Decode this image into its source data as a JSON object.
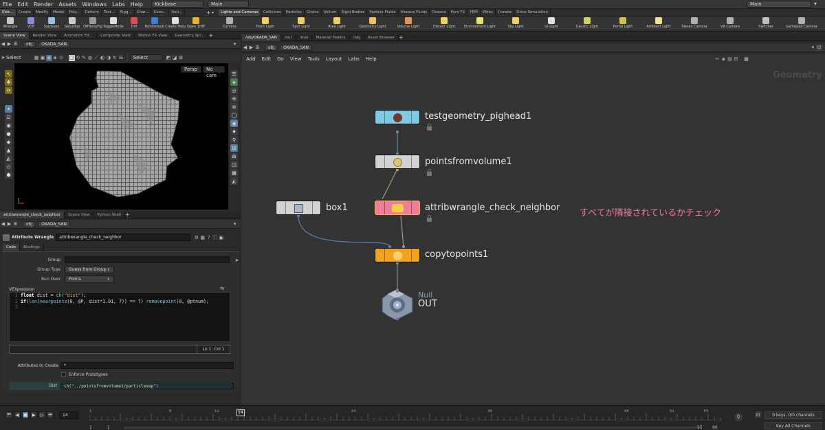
{
  "menu": {
    "items": [
      "File",
      "Edit",
      "Render",
      "Assets",
      "Windows",
      "Labs",
      "Help"
    ],
    "desktop": "Kickbase",
    "scene": "Main",
    "scene_right": "Main"
  },
  "shelf_tabs_left": [
    "Kick...",
    "Create",
    "Modify",
    "Model",
    "Poly...",
    "Deform",
    "Text...",
    "Rigg...",
    "Char...",
    "Cons...",
    "Hair..."
  ],
  "shelf_tabs_right": [
    "Lights and Cameras",
    "Collisions",
    "Particles",
    "Grains",
    "Vellum",
    "Rigid Bodies",
    "Particle Fluids",
    "Viscous Fluids",
    "Oceans",
    "Pyro FX",
    "FEM",
    "Wires",
    "Crowds",
    "Drive Simulation"
  ],
  "tools_left": [
    {
      "label": "Wrangle",
      "color": "#c8c8c8"
    },
    {
      "label": "VOP",
      "color": "#8a8ad8"
    },
    {
      "label": "SopSGeo",
      "color": "#9ac0e0"
    },
    {
      "label": "Geo2Rop",
      "color": "#cccccc"
    },
    {
      "label": "OffTempFig",
      "color": "#999999"
    },
    {
      "label": "ToggleMode",
      "color": "#dddddd"
    },
    {
      "label": "Diff",
      "color": "#d85050"
    },
    {
      "label": "NonDefault",
      "color": "#3a7fd5"
    },
    {
      "label": "Create Help",
      "color": "#e0e0e0"
    },
    {
      "label": "Open 1HIP",
      "color": "#e8b030"
    }
  ],
  "tools_right": [
    {
      "label": "Camera",
      "color": "#b0b0b0"
    },
    {
      "label": "Point Light",
      "color": "#f0d060"
    },
    {
      "label": "Spot Light",
      "color": "#f0d060"
    },
    {
      "label": "Area Light",
      "color": "#f0d060"
    },
    {
      "label": "Geometry Light",
      "color": "#f0c060"
    },
    {
      "label": "Volume Light",
      "color": "#f09050"
    },
    {
      "label": "Distant Light",
      "color": "#f0d060"
    },
    {
      "label": "Environment Light",
      "color": "#e8e070"
    },
    {
      "label": "Sky Light",
      "color": "#f0d060"
    },
    {
      "label": "GI Light",
      "color": "#e0e0e0"
    },
    {
      "label": "Caustic Light",
      "color": "#d0d060"
    },
    {
      "label": "Portal Light",
      "color": "#d0c050"
    },
    {
      "label": "Ambient Light",
      "color": "#f0e090"
    },
    {
      "label": "Stereo Camera",
      "color": "#b0b0b0"
    },
    {
      "label": "VR Camera",
      "color": "#b0b0b0"
    },
    {
      "label": "Switcher",
      "color": "#c0c0c0"
    },
    {
      "label": "Gamepad Camera",
      "color": "#b0b0b0"
    }
  ],
  "left_pane_tabs": [
    "Scene View",
    "Render View",
    "Animation Ed...",
    "Composite View",
    "Motion FX View",
    "Geometry Spr..."
  ],
  "right_pane_tabs": [
    "/obj/OKADA_SAN",
    "/out",
    "/mat",
    "Material Palette",
    "/obj",
    "Asset Browser"
  ],
  "path": {
    "context": "obj",
    "node": "OKADA_SAN"
  },
  "viewport": {
    "select": "Select",
    "select_mode": "Select",
    "persp": "Persp",
    "cam": "No cam"
  },
  "param_tabs": [
    "attribwrangle_check_neighbor",
    "Scene View",
    "Python Shell"
  ],
  "param": {
    "type": "Attribute Wrangle",
    "name": "attribwrangle_check_neighbor",
    "subtabs": [
      "Code",
      "Bindings"
    ],
    "group_label": "Group",
    "group_value": "",
    "group_type_label": "Group Type",
    "group_type_value": "Guess from Group",
    "run_over_label": "Run Over",
    "run_over_value": "Points",
    "vex_label": "VEXpression",
    "status": "Ln 1, Col 1",
    "attrs_label": "Attributes to Create",
    "attrs_value": "*",
    "enforce_label": "Enforce Prototypes",
    "dist_label": "Dist",
    "dist_value": "ch(\"../pointsfromvolume1/particlesep\")"
  },
  "network_menu": [
    "Add",
    "Edit",
    "Go",
    "View",
    "Tools",
    "Layout",
    "Labs",
    "Help"
  ],
  "network_title": "Geometry",
  "nodes": {
    "pighead": "testgeometry_pighead1",
    "pfv": "pointsfromvolume1",
    "box": "box1",
    "wrangle": "attribwrangle_check_neighbor",
    "ctp": "copytopoints1",
    "null_type": "Null",
    "out": "OUT"
  },
  "node_colors": {
    "pighead": "#7fc9e2",
    "pfv": "#d2d2d2",
    "box": "#d2d2d2",
    "wrangle": "#ef7c9b",
    "ctp": "#f2a31e"
  },
  "annotation": "すべてが隣接されているかチェック",
  "timeline": {
    "frame": "14",
    "ticks": [
      "1",
      "8",
      "12",
      "14",
      "24",
      "36",
      "48",
      "52",
      "55",
      "96"
    ],
    "start1": "1",
    "start2": "1",
    "end1": "55",
    "end2": "96",
    "keys": "0 keys, 0/0 channels",
    "key_all": "Key All Channels"
  }
}
